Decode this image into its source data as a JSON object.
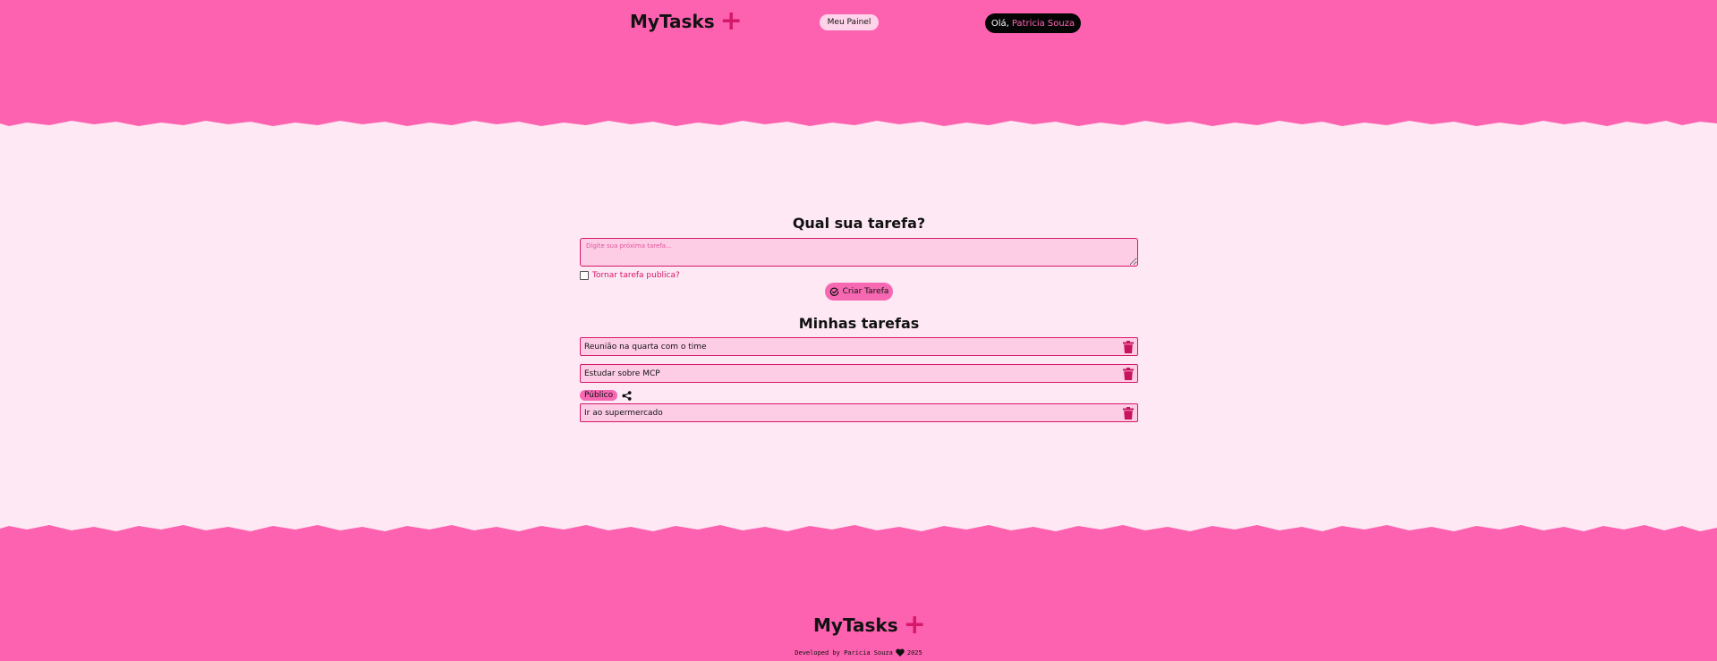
{
  "header": {
    "brand": "MyTasks",
    "brand_icon": "plus-icon",
    "panel_label": "Meu Painel",
    "greeting": "Olá,",
    "user_name": "Patricia Souza"
  },
  "form": {
    "title": "Qual sua tarefa?",
    "placeholder": "Digite sua próxima tarefa...",
    "value": "",
    "public_label": "Tornar tarefa publica?",
    "public_checked": false,
    "create_label": "Criar Tarefa"
  },
  "list": {
    "title": "Minhas tarefas",
    "public_badge": "Público",
    "tasks": [
      {
        "text": "Reunião na quarta com o time",
        "public": false
      },
      {
        "text": "Estudar sobre MCP",
        "public": false
      },
      {
        "text": "Ir ao supermercado",
        "public": true
      }
    ]
  },
  "footer": {
    "brand": "MyTasks",
    "credit_prefix": "Developed by Paricia Souza",
    "credit_year": "2025"
  },
  "colors": {
    "primary": "#fc62b0",
    "accent": "#d6186a",
    "background": "#fde8f3",
    "input_bg": "#fdcde6"
  }
}
